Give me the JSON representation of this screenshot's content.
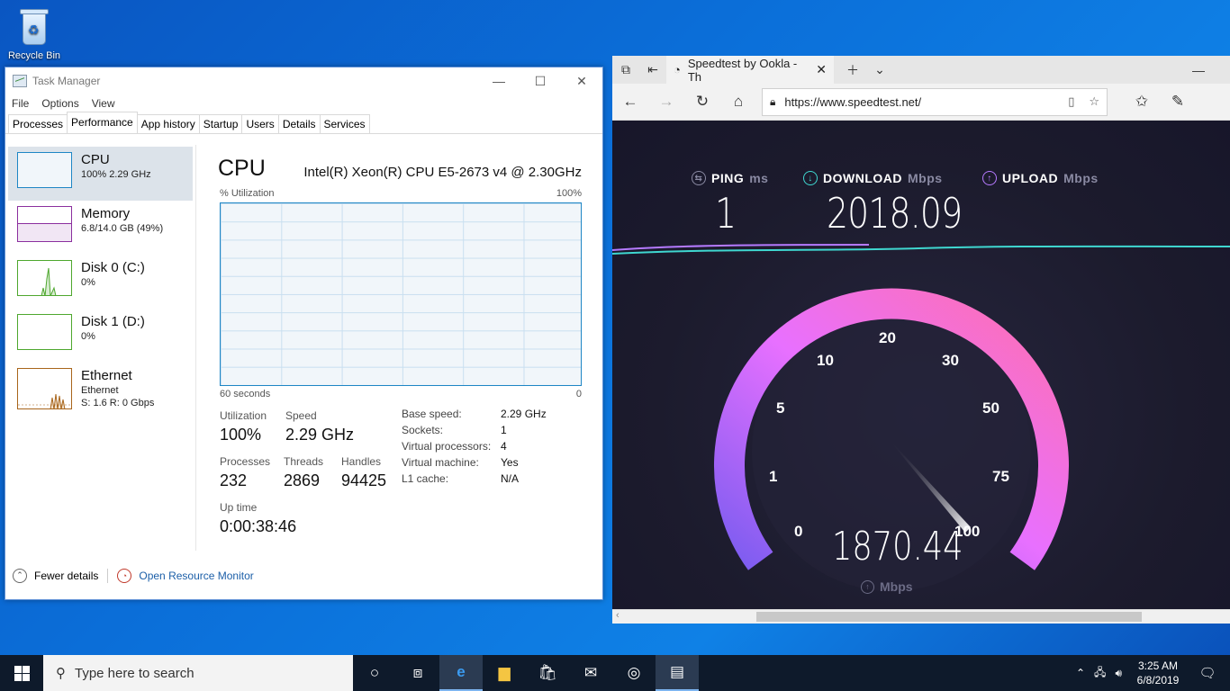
{
  "desktop": {
    "recycle_bin": "Recycle Bin"
  },
  "taskmgr": {
    "title": "Task Manager",
    "menu": [
      "File",
      "Options",
      "View"
    ],
    "tabs": [
      "Processes",
      "Performance",
      "App history",
      "Startup",
      "Users",
      "Details",
      "Services"
    ],
    "active_tab": "Performance",
    "resources": [
      {
        "name": "CPU",
        "sub1": "100%  2.29 GHz",
        "sub2": "",
        "color": "#1e86c5"
      },
      {
        "name": "Memory",
        "sub1": "6.8/14.0 GB (49%)",
        "sub2": "",
        "color": "#8b2f9e"
      },
      {
        "name": "Disk 0 (C:)",
        "sub1": "0%",
        "sub2": "",
        "color": "#4ea72e"
      },
      {
        "name": "Disk 1 (D:)",
        "sub1": "0%",
        "sub2": "",
        "color": "#4ea72e"
      },
      {
        "name": "Ethernet",
        "sub1": "Ethernet",
        "sub2": "S: 1.6  R: 0 Gbps",
        "color": "#a8651b"
      }
    ],
    "cpu": {
      "title": "CPU",
      "model": "Intel(R) Xeon(R) CPU E5-2673 v4 @ 2.30GHz",
      "util_label": "% Utilization",
      "util_max": "100%",
      "time_label": "60 seconds",
      "time_min": "0",
      "utilization_label": "Utilization",
      "utilization": "100%",
      "speed_label": "Speed",
      "speed": "2.29 GHz",
      "processes_label": "Processes",
      "processes": "232",
      "threads_label": "Threads",
      "threads": "2869",
      "handles_label": "Handles",
      "handles": "94425",
      "uptime_label": "Up time",
      "uptime": "0:00:38:46",
      "details": [
        {
          "k": "Base speed:",
          "v": "2.29 GHz"
        },
        {
          "k": "Sockets:",
          "v": "1"
        },
        {
          "k": "Virtual processors:",
          "v": "4"
        },
        {
          "k": "Virtual machine:",
          "v": "Yes"
        },
        {
          "k": "L1 cache:",
          "v": "N/A"
        }
      ]
    },
    "footer": {
      "fewer": "Fewer details",
      "monitor": "Open Resource Monitor"
    }
  },
  "browser": {
    "tab_title": "Speedtest by Ookla - Th",
    "url": "https://www.speedtest.net/",
    "ping_label": "PING",
    "ping_unit": "ms",
    "ping": "1",
    "download_label": "DOWNLOAD",
    "download_unit": "Mbps",
    "download": "2018.09",
    "upload_label": "UPLOAD",
    "upload_unit": "Mbps",
    "gauge_ticks": [
      "0",
      "1",
      "5",
      "10",
      "20",
      "30",
      "50",
      "75",
      "100"
    ],
    "speed": "1870.44",
    "speed_unit": "Mbps",
    "speed_value": 1870.44,
    "colors": {
      "ping": "#8a8aa3",
      "download": "#3fd7d0",
      "upload": "#b57aff",
      "gauge_start": "#7b5cf0",
      "gauge_end": "#ff6fb0"
    }
  },
  "taskbar": {
    "search_placeholder": "Type here to search",
    "time": "3:25 AM",
    "date": "6/8/2019"
  }
}
